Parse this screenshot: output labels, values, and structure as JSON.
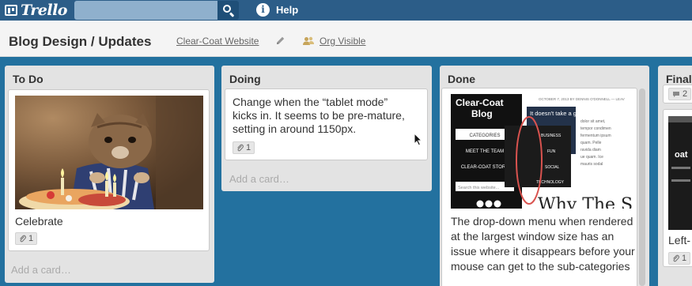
{
  "header": {
    "logo_text": "Trello",
    "search": {
      "value": "",
      "placeholder": ""
    },
    "help_label": "Help"
  },
  "board": {
    "title": "Blog Design / Updates",
    "organization": "Clear-Coat Website",
    "visibility": "Org Visible"
  },
  "lists": [
    {
      "title": "To Do",
      "cards": [
        {
          "title": "Celebrate",
          "image": "cat-birthday-cake-photo",
          "attachments": "1"
        }
      ],
      "add_card_label": "Add a card…"
    },
    {
      "title": "Doing",
      "cards": [
        {
          "title": "Change when the “tablet mode” kicks in. It seems to be pre-mature, setting in around 1150px.",
          "attachments": "1"
        }
      ],
      "add_card_label": "Add a card…"
    },
    {
      "title": "Done",
      "cards": [
        {
          "title": "The drop-down menu when rendered at the largest window size has an issue where it disappears before your mouse can get to the sub-categories",
          "image": "blog-screenshot",
          "screenshot": {
            "blog_name_line1": "Clear-Coat",
            "blog_name_line2": "Blog",
            "nav": [
              "CATEGORIES",
              "MEET THE TEAM",
              "CLEAR-COAT STORE"
            ],
            "search_placeholder": "Search this website...",
            "byline": "OCTOBER 7, 2013 BY DENNIS O'DONNELL — LEAV",
            "headline": "It doesn't take a genius.",
            "dropdown": [
              "BUSINESS",
              "FUN",
              "SOCIAL",
              "TECHNOLOGY"
            ],
            "big_title": "Why The S",
            "body_lines": [
              "dolor sit amet,",
              "tempor condimen",
              "fermentum ipsum",
              "quam. Pelle",
              "ravida diam",
              "ue quam. Ice",
              "mauris sodal"
            ]
          }
        }
      ]
    },
    {
      "title": "Final",
      "cards": [
        {
          "comments": "2"
        },
        {
          "title": "Left-",
          "image": "dark-thumbnail",
          "thumb_text": "oat",
          "attachments": "1"
        }
      ]
    }
  ],
  "colors": {
    "header": "#2c5d88",
    "board_background": "#23719f",
    "list_background": "#e3e3e3",
    "annotation": "#d9534f"
  }
}
